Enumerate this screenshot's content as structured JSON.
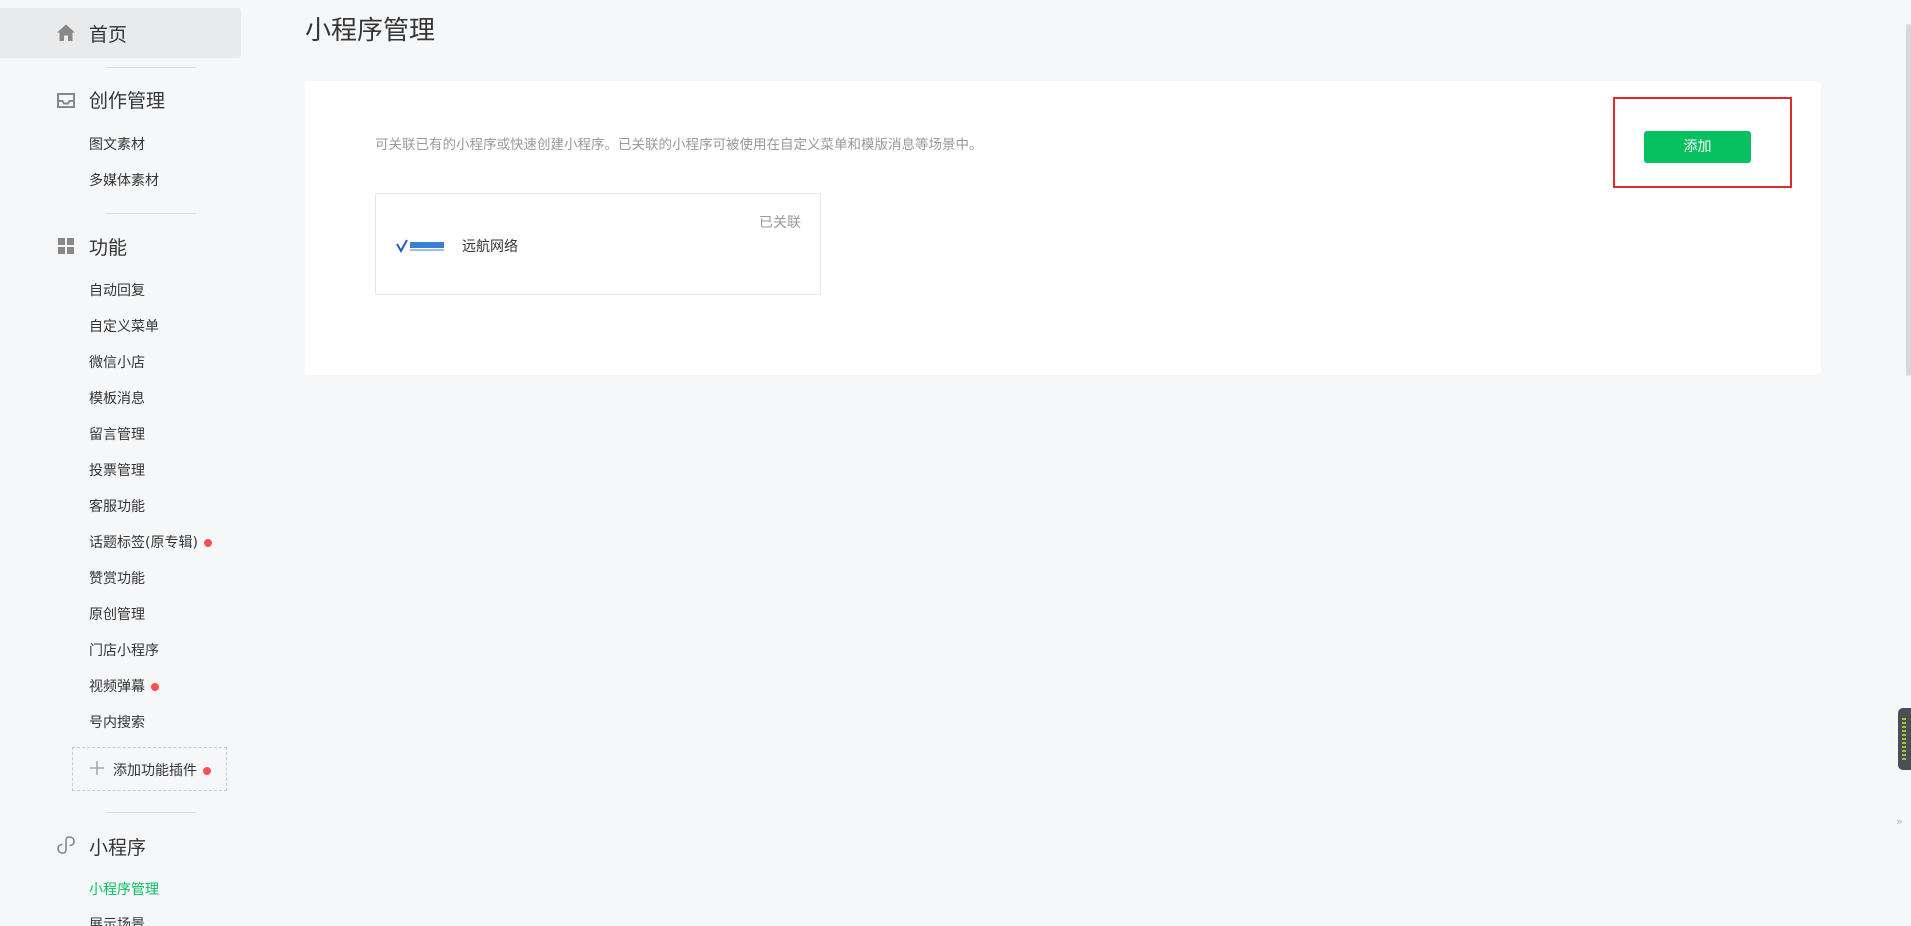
{
  "sidebar": {
    "home": {
      "label": "首页",
      "icon": "home-icon"
    },
    "creation": {
      "title": "创作管理",
      "icon": "inbox-icon",
      "items": [
        "图文素材",
        "多媒体素材"
      ]
    },
    "features": {
      "title": "功能",
      "icon": "grid-icon",
      "items": [
        {
          "label": "自动回复",
          "dot": false
        },
        {
          "label": "自定义菜单",
          "dot": false
        },
        {
          "label": "微信小店",
          "dot": false
        },
        {
          "label": "模板消息",
          "dot": false
        },
        {
          "label": "留言管理",
          "dot": false
        },
        {
          "label": "投票管理",
          "dot": false
        },
        {
          "label": "客服功能",
          "dot": false
        },
        {
          "label": "话题标签(原专辑)",
          "dot": true
        },
        {
          "label": "赞赏功能",
          "dot": false
        },
        {
          "label": "原创管理",
          "dot": false
        },
        {
          "label": "门店小程序",
          "dot": false
        },
        {
          "label": "视频弹幕",
          "dot": true
        },
        {
          "label": "号内搜索",
          "dot": false
        }
      ],
      "add_plugin": {
        "label": "添加功能插件",
        "icon": "plus-icon",
        "dot": true
      }
    },
    "miniprogram": {
      "title": "小程序",
      "icon": "link-icon",
      "items": [
        {
          "label": "小程序管理",
          "active": true
        },
        {
          "label": "展示场景",
          "active": false
        }
      ]
    }
  },
  "main": {
    "title": "小程序管理",
    "description": "可关联已有的小程序或快速创建小程序。已关联的小程序可被使用在自定义菜单和模版消息等场景中。",
    "add_button": "添加",
    "linked_app": {
      "name": "远航网络",
      "status": "已关联",
      "logo_icon": "app-logo-icon"
    }
  },
  "colors": {
    "accent": "#07c160",
    "highlight": "#e22a2a",
    "dot": "#fa5151",
    "background": "#f6f7f9"
  }
}
